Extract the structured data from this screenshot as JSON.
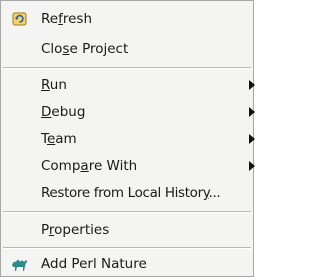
{
  "menu": {
    "refresh": {
      "pre": "Re",
      "mn": "f",
      "post": "resh",
      "icon": "refresh-icon"
    },
    "close_project": {
      "pre": "Clo",
      "mn": "s",
      "post": "e Project"
    },
    "run": {
      "pre": "",
      "mn": "R",
      "post": "un",
      "submenu": true
    },
    "debug": {
      "pre": "",
      "mn": "D",
      "post": "ebug",
      "submenu": true
    },
    "team": {
      "pre": "T",
      "mn": "e",
      "post": "am",
      "submenu": true
    },
    "compare_with": {
      "pre": "Comp",
      "mn": "a",
      "post": "re With",
      "submenu": true
    },
    "restore_local_history": {
      "pre": "Restore from Local Histor",
      "mn": "y",
      "post": "..."
    },
    "properties": {
      "pre": "P",
      "mn": "r",
      "post": "operties"
    },
    "add_perl_nature": {
      "pre": "Add Perl Nature",
      "mn": "",
      "post": "",
      "icon": "camel-icon"
    }
  },
  "colors": {
    "menu_background": "#f4f4f2",
    "separator": "#b8b8b8",
    "text": "#1a1a1a"
  }
}
